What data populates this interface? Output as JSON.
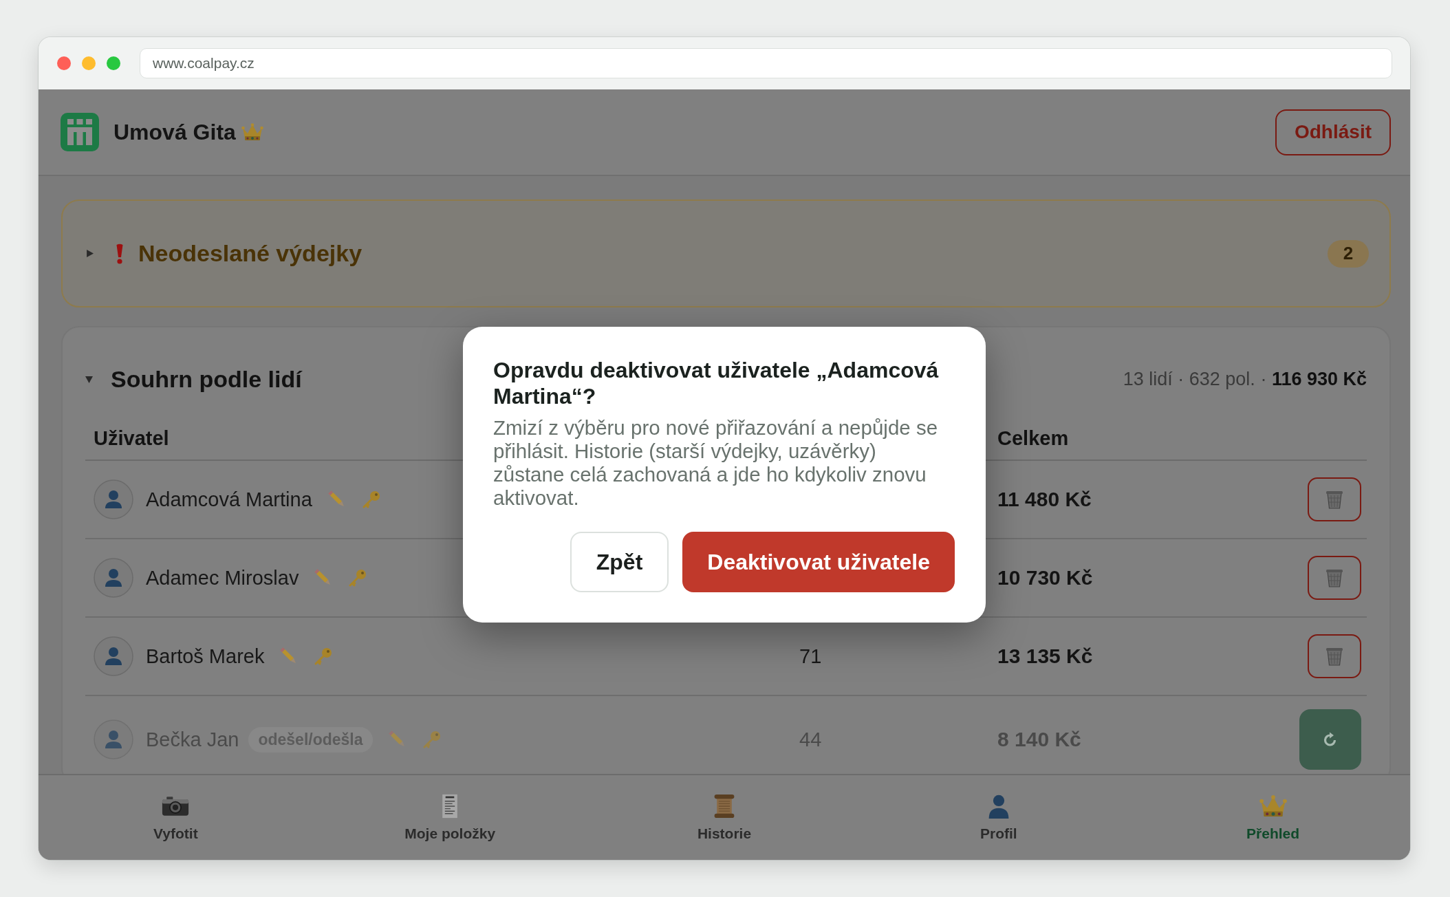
{
  "browser": {
    "url": "www.coalpay.cz"
  },
  "header": {
    "user_name": "Umová Gita",
    "logout_button": "Odhlásit"
  },
  "unsent_panel": {
    "title": "Neodeslané výdejky",
    "expanded": false,
    "count": "2"
  },
  "summary": {
    "title": "Souhrn podle lidí",
    "expanded": true,
    "stats": "13 lidí · 632 pol. · **116 930 Kč**",
    "columns": {
      "user": "Uživatel",
      "total": "Celkem"
    },
    "rows": [
      {
        "name": "Adamcová Martina",
        "active": true,
        "total": "11 480 Kč"
      },
      {
        "name": "Adamec Miroslav",
        "active": true,
        "total": "10 730 Kč"
      },
      {
        "name": "Bartoš Marek",
        "active": true,
        "count": "71",
        "total": "13 135 Kč"
      },
      {
        "name": "Bečka Jan",
        "active": false,
        "tag": "odešel/odešla",
        "count": "44",
        "total": "8 140 Kč"
      }
    ]
  },
  "dialog": {
    "title": "Opravdu deaktivovat uživatele „Adamcová Martina“?",
    "message": "Zmizí z výběru pro nové přiřazování a nepůjde se přihlásit. Historie (starší výdejky, uzávěrky) zůstane celá zachovaná a jde ho kdykoliv znovu aktivovat.",
    "buttons": [
      {
        "label": "Zpět",
        "kind": "secondary"
      },
      {
        "label": "Deaktivovat uživatele",
        "kind": "danger"
      }
    ]
  },
  "bottom_nav": [
    {
      "label": "Vyfotit",
      "selected": false
    },
    {
      "label": "Moje položky",
      "selected": false
    },
    {
      "label": "Historie",
      "selected": false
    },
    {
      "label": "Profil",
      "selected": false
    },
    {
      "label": "Přehled",
      "selected": true
    }
  ]
}
